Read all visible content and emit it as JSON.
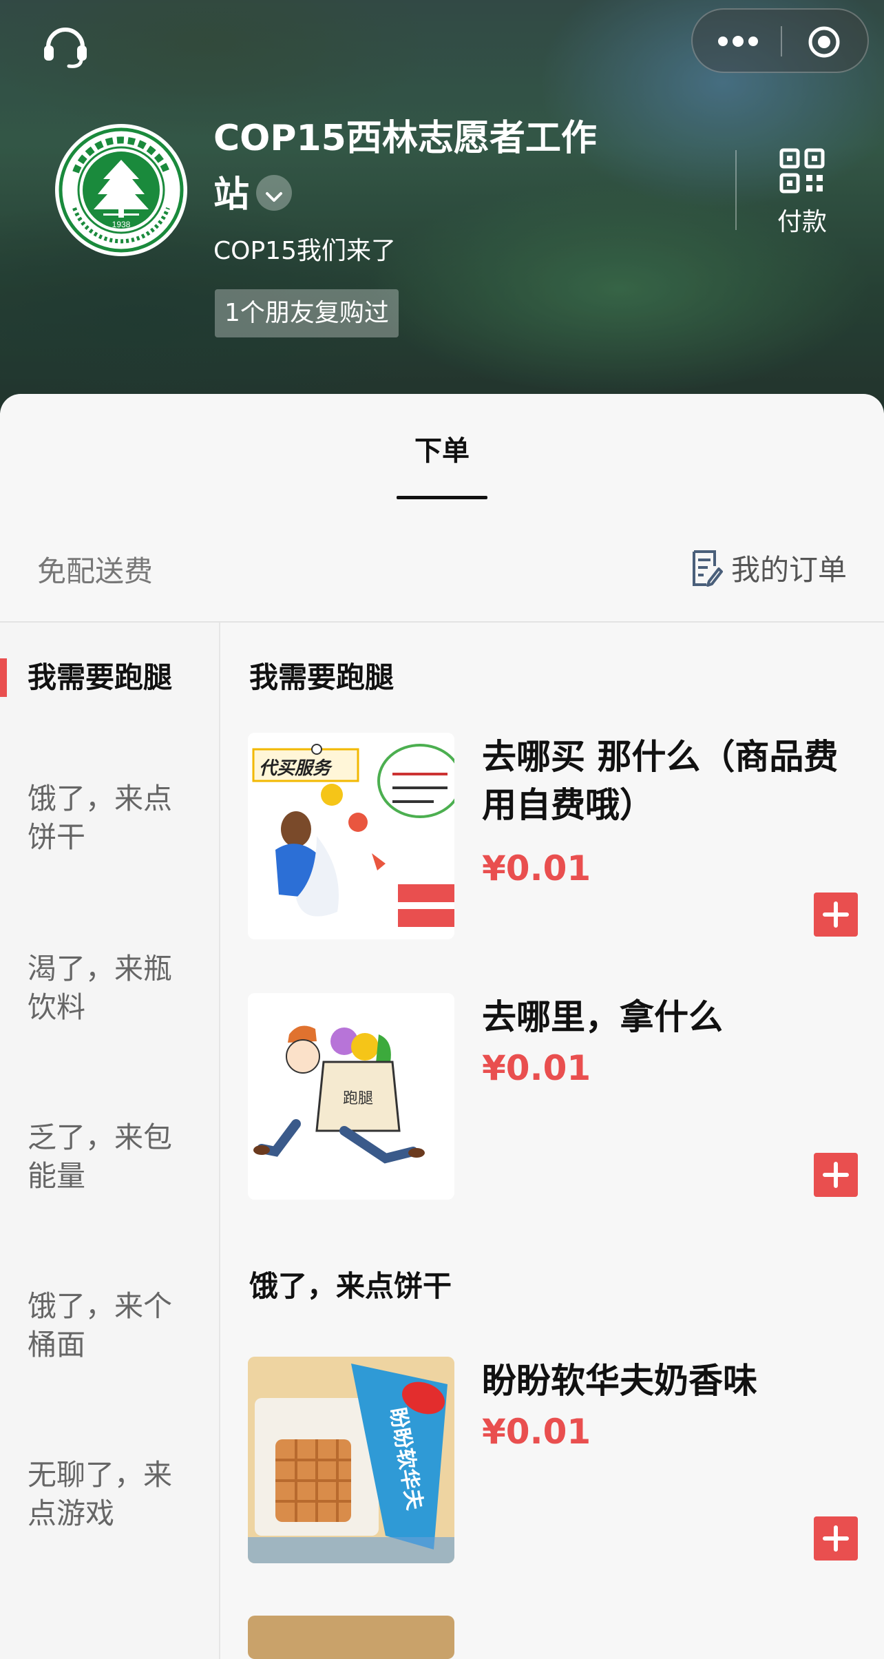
{
  "header": {
    "shop_name": "COP15西林志愿者工作站",
    "shop_name_line1": "COP15西林志愿者工作",
    "shop_name_line2": "站",
    "subtitle": "COP15我们来了",
    "friend_badge": "1个朋友复购过",
    "pay_label": "付款",
    "logo_year": "1938"
  },
  "tabs": [
    {
      "label": "下单",
      "active": true
    }
  ],
  "info_bar": {
    "delivery_text": "免配送费",
    "my_orders": "我的订单"
  },
  "sidebar": {
    "categories": [
      {
        "label": "我需要跑腿",
        "active": true
      },
      {
        "label": "饿了，来点饼干"
      },
      {
        "label": "渴了，来瓶饮料"
      },
      {
        "label": "乏了，来包能量"
      },
      {
        "label": "饿了，来个桶面"
      },
      {
        "label": "无聊了，来点游戏"
      }
    ]
  },
  "sections": [
    {
      "title": "我需要跑腿",
      "items": [
        {
          "name": "去哪买 那什么（商品费用自费哦）",
          "price": "¥0.01",
          "image_text": "代买服务"
        },
        {
          "name": "去哪里，拿什么",
          "price": "¥0.01",
          "image_text": "跑腿"
        }
      ]
    },
    {
      "title": "饿了，来点饼干",
      "items": [
        {
          "name": "盼盼软华夫奶香味",
          "price": "¥0.01",
          "image_text": "盼盼软华夫"
        }
      ]
    }
  ],
  "colors": {
    "accent": "#e94f4f",
    "logo_green": "#1a8a3c",
    "text_primary": "#111111",
    "text_secondary": "#777777"
  },
  "icons": [
    "headset-icon",
    "more-icon",
    "target-icon",
    "chevron-down-icon",
    "qr-code-icon",
    "order-list-icon",
    "plus-icon"
  ]
}
